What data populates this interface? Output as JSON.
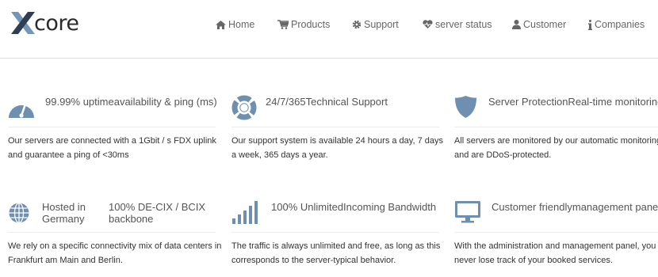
{
  "brand": {
    "logo_text": "core",
    "logo_letter": "X"
  },
  "nav": {
    "items": [
      {
        "label": "Home",
        "icon": "home-icon"
      },
      {
        "label": "Products",
        "icon": "cart-icon"
      },
      {
        "label": "Support",
        "icon": "gear-icon"
      },
      {
        "label": "server status",
        "icon": "heartbeat-icon"
      },
      {
        "label": "Customer",
        "icon": "user-icon"
      },
      {
        "label": "Companies",
        "icon": "info-icon"
      }
    ]
  },
  "features": [
    {
      "title": "99.99% uptimeavailability & ping (ms)",
      "text": "Our servers are connected with a 1Gbit / s FDX uplink and guarantee a ping of <30ms",
      "icon": "speedometer-icon"
    },
    {
      "title": "24/7/365Technical Support",
      "text": "Our support system is available 24 hours a day, 7 days a week, 365 days a year.",
      "icon": "lifebuoy-icon"
    },
    {
      "title": "Server ProtectionReal-time monitoring",
      "text": "All servers are monitored by our automatic monitoring and are DDoS-protected.",
      "icon": "shield-icon"
    },
    {
      "title_a": "Hosted in Germany",
      "title_b": "100% DE-CIX / BCIX backbone",
      "text": "We rely on a specific connectivity mix of data centers in Frankfurt am Main and Berlin.",
      "icon": "globe-icon"
    },
    {
      "title": "100% UnlimitedIncoming Bandwidth",
      "text": "The traffic is always unlimited and free, as long as this corresponds to the server-typical behavior.",
      "icon": "bandwidth-bars-icon"
    },
    {
      "title": "Customer friendlymanagement panel",
      "text": "With the administration and management panel, you never lose track of your booked services.",
      "icon": "monitor-icon"
    }
  ],
  "colors": {
    "icon": "#6f8fb0",
    "nav_text": "#666666",
    "rule": "#ececec"
  }
}
